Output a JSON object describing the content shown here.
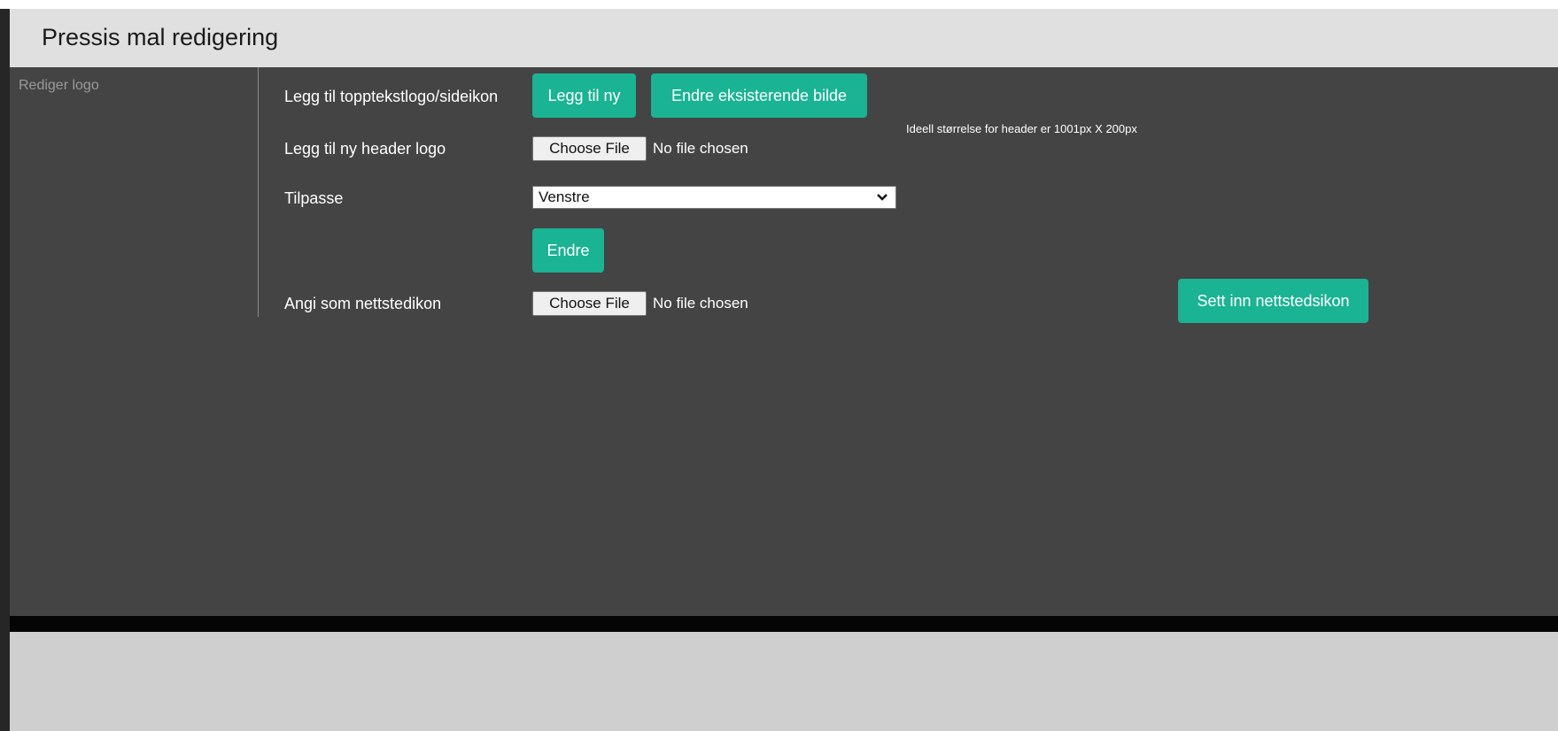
{
  "header": {
    "title": "Pressis mal redigering"
  },
  "sidebar": {
    "items": [
      {
        "label": "Rediger logo"
      }
    ]
  },
  "form": {
    "row1": {
      "label": "Legg til topptekstlogo/sideikon",
      "add_new_button": "Legg til ny",
      "change_existing_button": "Endre eksisterende bilde"
    },
    "row2": {
      "label": "Legg til ny header logo",
      "file_button": "Choose File",
      "file_status": "No file chosen",
      "hint": "Ideell størrelse for header er 1001px X 200px"
    },
    "row3": {
      "label": "Tilpasse",
      "select_value": "Venstre"
    },
    "row4": {
      "submit_button": "Endre"
    },
    "row5": {
      "label": "Angi som nettstedikon",
      "file_button": "Choose File",
      "file_status": "No file chosen",
      "insert_button": "Sett inn nettstedsikon"
    }
  },
  "colors": {
    "accent": "#1ab394",
    "content_bg": "#444444",
    "header_bg": "#e0e0e0",
    "footer_bg": "#cfcfcf"
  },
  "icons": {
    "select_chevron": "chevron-down-icon"
  }
}
